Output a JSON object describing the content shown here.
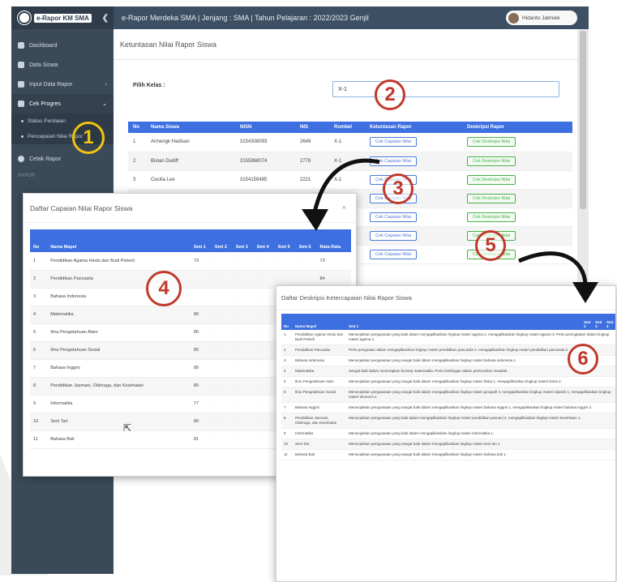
{
  "app": {
    "brand": "e-Rapor KM SMA",
    "topbar_title": "e-Rapor Merdeka SMA | Jenjang : SMA | Tahun Pelajaran : 2022/2023 Genjil",
    "user_name": "Hidanto Jatmiek"
  },
  "sidebar": {
    "items": [
      {
        "label": "Dashboard"
      },
      {
        "label": "Data Siswa"
      },
      {
        "label": "Input Data Rapor"
      },
      {
        "label": "Cek Progres"
      }
    ],
    "subitems": [
      {
        "label": "Status Penilaian"
      },
      {
        "label": "Pencapaian Nilai Rapor"
      }
    ],
    "bottom_item": "Cetak Rapor",
    "section": "RAPOR"
  },
  "page": {
    "title": "Ketuntasan Nilai Rapor Siswa",
    "kelas_label": "Pilih Kelas :",
    "kelas_value": "X-1"
  },
  "main_table": {
    "headers": [
      "No",
      "Nama Siswa",
      "NISN",
      "NIS",
      "Rombel",
      "Ketuntasan Rapor",
      "Deskripsi Rapor"
    ],
    "rows": [
      {
        "no": "1",
        "nama": "Armengk Hadisan",
        "nisn": "3154308093",
        "nis": "2649",
        "rombel": "X-1"
      },
      {
        "no": "2",
        "nama": "Bistan Dudiff",
        "nisn": "3155968074",
        "nis": "2778",
        "rombel": "X-1"
      },
      {
        "no": "3",
        "nama": "Cecilia Lee",
        "nisn": "3154156485",
        "nis": "2221",
        "rombel": "X-1"
      }
    ],
    "btn_capaian": "Cek Capaian Nilai",
    "btn_deskripsi": "Cek Deskripsi Nilai"
  },
  "modal_capaian": {
    "title": "Daftar Capaian Nilai Rapor Siswa",
    "close": "×",
    "headers": [
      "No",
      "Nama Mapel",
      "Smt 1",
      "Smt 2",
      "Smt 3",
      "Smt 4",
      "Smt 5",
      "Smt 6",
      "Rata-Rata"
    ],
    "rows": [
      {
        "no": "1",
        "mapel": "Pendidikan Agama Hindu dan Budi Pekerti",
        "smt1": "73",
        "avg": "73"
      },
      {
        "no": "2",
        "mapel": "Pendidikan Pancasila",
        "smt1": "",
        "avg": "84"
      },
      {
        "no": "3",
        "mapel": "Bahasa Indonesia",
        "smt1": "",
        "avg": ""
      },
      {
        "no": "4",
        "mapel": "Matematika",
        "smt1": "80",
        "avg": ""
      },
      {
        "no": "5",
        "mapel": "Ilmu Pengetahuan Alam",
        "smt1": "80",
        "avg": ""
      },
      {
        "no": "6",
        "mapel": "Ilmu Pengetahuan Sosial",
        "smt1": "80",
        "avg": ""
      },
      {
        "no": "7",
        "mapel": "Bahasa Inggris",
        "smt1": "80",
        "avg": ""
      },
      {
        "no": "8",
        "mapel": "Pendidikan Jasmani, Olahraga, dan Kesehatan",
        "smt1": "80",
        "avg": ""
      },
      {
        "no": "9",
        "mapel": "Informatika",
        "smt1": "77",
        "avg": ""
      },
      {
        "no": "10",
        "mapel": "Seni Tari",
        "smt1": "80",
        "avg": ""
      },
      {
        "no": "11",
        "mapel": "Bahasa Bali",
        "smt1": "81",
        "avg": ""
      }
    ]
  },
  "modal_deskripsi": {
    "title": "Daftar Deskripsi Ketercapaian Nilai Rapor Siswa",
    "headers": [
      "No",
      "Nama Mapel",
      "Smt 1",
      "Smt 2",
      "Smt 3",
      "Smt 4"
    ],
    "rows": [
      {
        "no": "1",
        "mapel": "Pendidikan Agama Hindu dan Budi Pekerti",
        "desc": "Menunjukkan penguasaan yang baik dalam mengaplikasikan lingkup materi agama 2, mengaplikasikan lingkup materi agama 3. Perlu peningkatan dalam lingkup materi agama 1."
      },
      {
        "no": "2",
        "mapel": "Pendidikan Pancasila",
        "desc": "Perlu penguatan dalam mengaplikasikan lingkup materi pendidikan pancasila 2, mengaplikasikan lingkup materi pendidikan pancasila 3."
      },
      {
        "no": "3",
        "mapel": "Bahasa Indonesia",
        "desc": "Menunjukkan penguasaan yang sangat baik dalam mengaplikasikan lingkup materi bahasa indonesia 1."
      },
      {
        "no": "4",
        "mapel": "Matematika",
        "desc": "Sangat baik dalam menerapkan konsep matematika. Perlu bimbingan dalam pemecahan masalah."
      },
      {
        "no": "5",
        "mapel": "Ilmu Pengetahuan Alam",
        "desc": "Menunjukkan penguasaan yang sangat baik dalam mengaplikasikan lingkup materi fisika 1, mengaplikasikan lingkup materi kimia 2."
      },
      {
        "no": "6",
        "mapel": "Ilmu Pengetahuan Sosial",
        "desc": "Menunjukkan penguasaan yang sangat baik dalam mengaplikasikan lingkup materi geografi 3, mengaplikasikan lingkup materi sejarah 1, mengaplikasikan lingkup materi ekonomi 2."
      },
      {
        "no": "7",
        "mapel": "Bahasa Inggris",
        "desc": "Menunjukkan penguasaan yang sangat baik dalam mengaplikasikan lingkup materi bahasa inggris 1, mengaplikasikan lingkup materi bahasa inggris 2."
      },
      {
        "no": "8",
        "mapel": "Pendidikan Jasmani, Olahraga, dan Kesehatan",
        "desc": "Menunjukkan penguasaan yang baik dalam mengaplikasikan lingkup materi pendidikan jasmani 2, mengaplikasikan lingkup materi kesehatan 1."
      },
      {
        "no": "9",
        "mapel": "Informatika",
        "desc": "Menunjukkan penguasaan yang baik dalam mengaplikasikan lingkup materi informatika 1."
      },
      {
        "no": "10",
        "mapel": "Seni Tari",
        "desc": "Menunjukkan penguasaan yang sangat baik dalam mengaplikasikan lingkup materi seni tari 1."
      },
      {
        "no": "11",
        "mapel": "Bahasa Bali",
        "desc": "Menunjukkan penguasaan yang sangat baik dalam mengaplikasikan lingkup materi bahasa bali 1."
      }
    ]
  },
  "annotations": {
    "m1": "1",
    "m2": "2",
    "m3": "3",
    "m4": "4",
    "m5": "5",
    "m6": "6",
    "accent_red": "#c0392b",
    "accent_yellow": "#f1c40f"
  },
  "theme": {
    "primary": "#3d6fe0",
    "sidebar": "#3b4a59",
    "topbar": "#3c4f63"
  }
}
